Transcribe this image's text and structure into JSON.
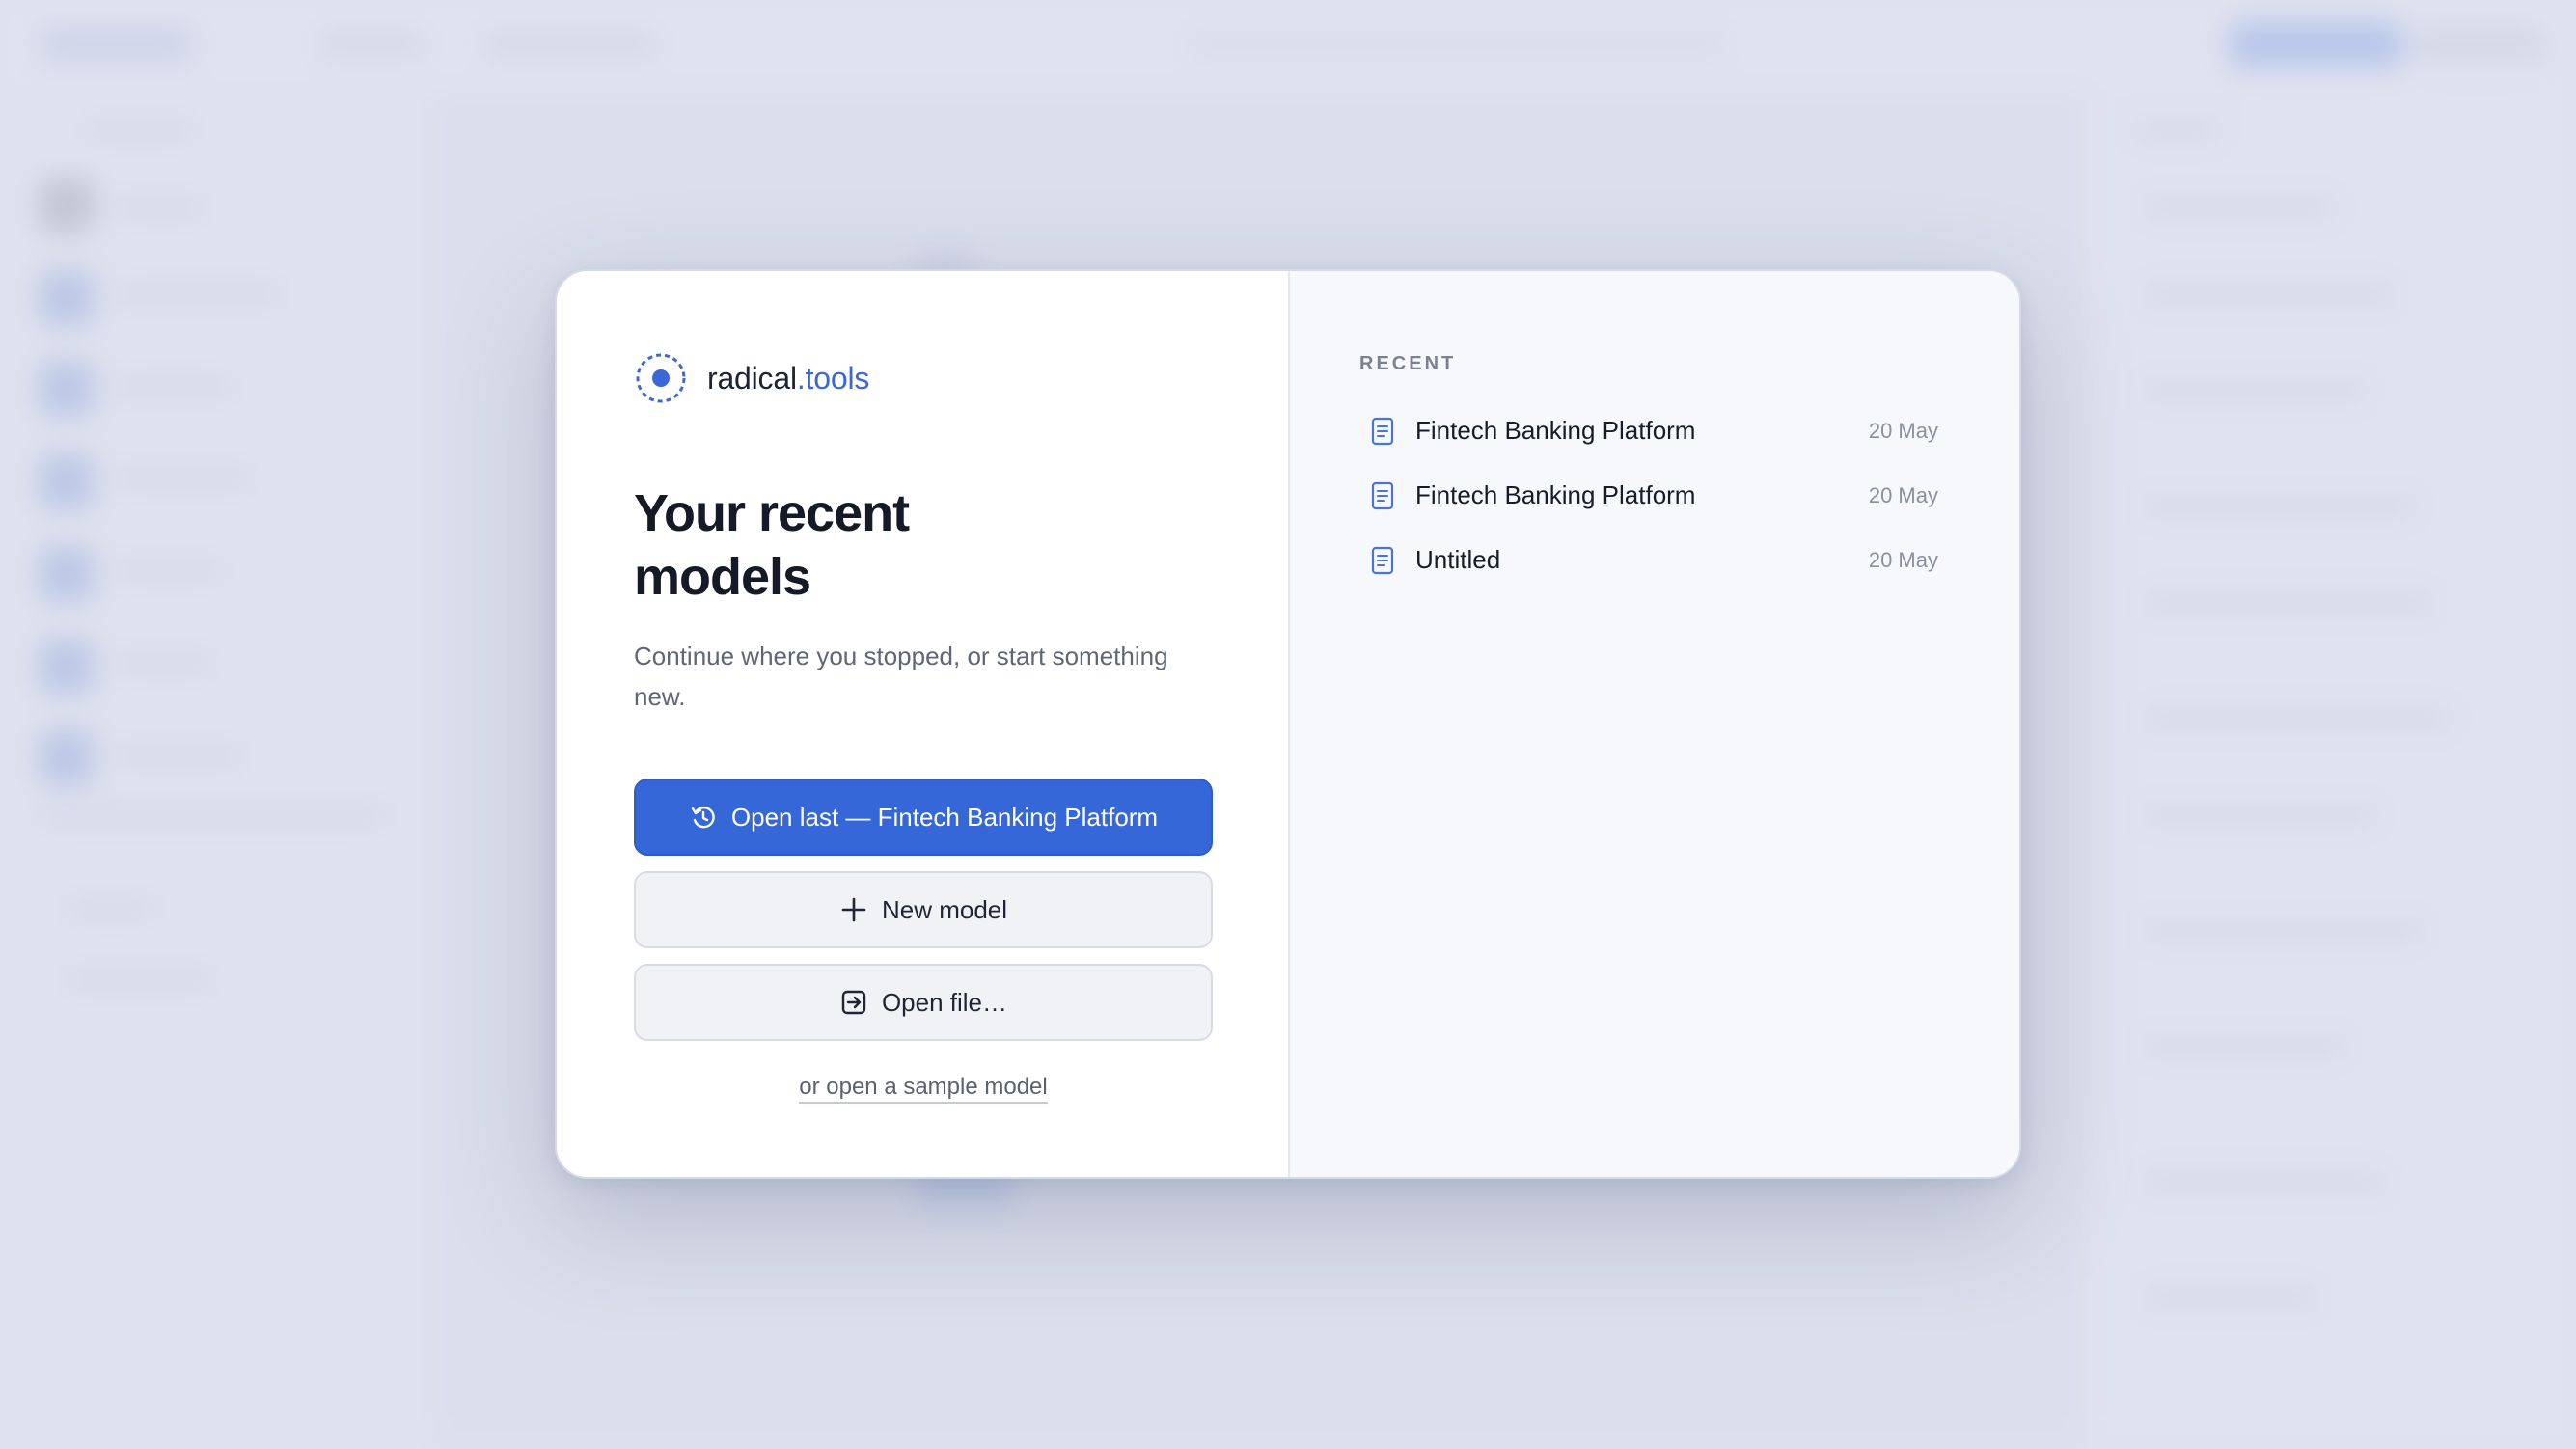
{
  "brand": {
    "name": "radical",
    "accent": ".tools",
    "accent_color": "#3a68d8"
  },
  "welcome": {
    "title": "Your recent models",
    "subtitle": "Continue where you stopped, or start something new.",
    "open_last_label": "Open last — Fintech Banking Platform",
    "new_model_label": "New model",
    "open_file_label": "Open file…",
    "sample_link_label": "or open a sample model"
  },
  "recent": {
    "heading": "RECENT",
    "items": [
      {
        "name": "Fintech Banking Platform",
        "date": "20 May",
        "icon": "document-icon"
      },
      {
        "name": "Fintech Banking Platform",
        "date": "20 May",
        "icon": "document-icon"
      },
      {
        "name": "Untitled",
        "date": "20 May",
        "icon": "document-icon"
      }
    ]
  },
  "icons": {
    "open_last": "history-icon",
    "new_model": "plus-icon",
    "open_file": "import-icon",
    "logo": "radical-logo-icon"
  },
  "colors": {
    "primary": "#3567d9",
    "background": "#e6e9f2",
    "modal_right_bg": "#f7f8fb"
  }
}
